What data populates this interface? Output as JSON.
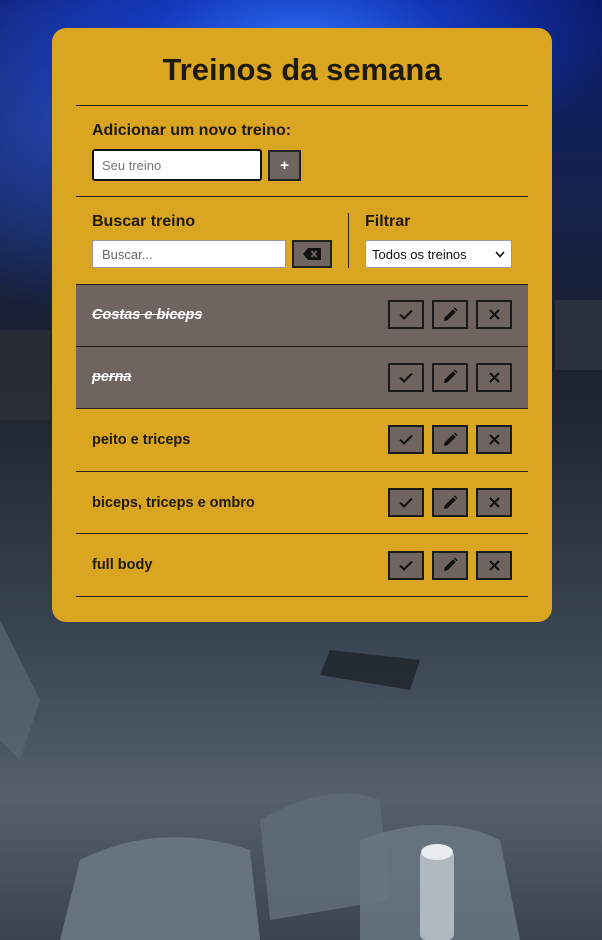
{
  "page": {
    "title": "Treinos da semana",
    "accent_color": "#daa520",
    "button_color": "#6f6460"
  },
  "add_form": {
    "label": "Adicionar um novo treino:",
    "input_value": "",
    "input_placeholder": "Seu treino",
    "submit_icon": "plus-icon",
    "submit_label": "+"
  },
  "search": {
    "label": "Buscar treino",
    "input_value": "",
    "input_placeholder": "Buscar...",
    "clear_icon": "backspace-icon"
  },
  "filter": {
    "label": "Filtrar",
    "selected": "Todos os treinos"
  },
  "todos": [
    {
      "text": "Costas e biceps",
      "done": true
    },
    {
      "text": "perna",
      "done": true
    },
    {
      "text": "peito e triceps",
      "done": false
    },
    {
      "text": "biceps, triceps e ombro",
      "done": false
    },
    {
      "text": "full body",
      "done": false
    }
  ],
  "item_actions": [
    "check-icon",
    "pencil-icon",
    "close-icon"
  ]
}
